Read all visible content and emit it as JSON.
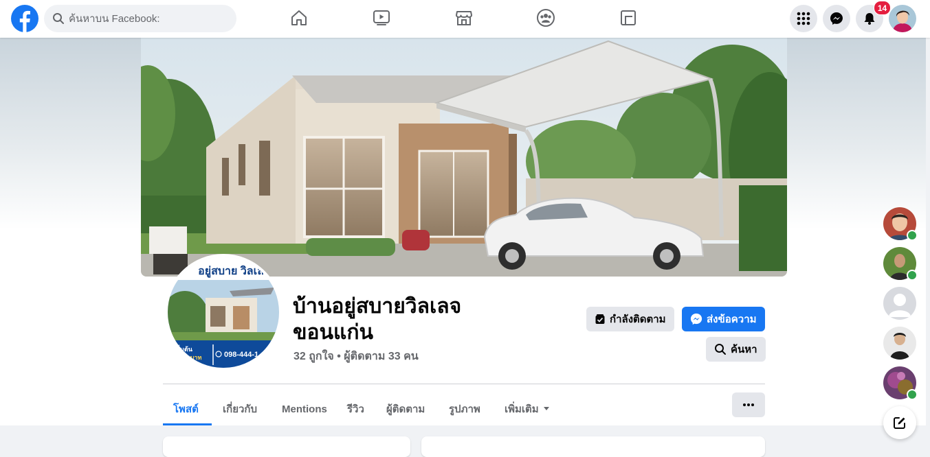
{
  "search": {
    "placeholder": "ค้นหาบน Facebook:"
  },
  "header": {
    "notification_count": "14",
    "colors": {
      "brand": "#1877f2",
      "badge": "#e41e3f",
      "online": "#31a24c"
    },
    "nav_icons": [
      "home-icon",
      "watch-icon",
      "marketplace-icon",
      "groups-icon",
      "gaming-icon"
    ],
    "action_icons": [
      "menu-grid-icon",
      "messenger-icon",
      "bell-icon"
    ]
  },
  "profile": {
    "name_line1": "บ้านอยู่สบายวิลเลจ",
    "name_line2": "ขอนแก่น",
    "stats": "32 ถูกใจ • ผู้ติดตาม 33 คน",
    "pic_banner": "อยู่สบาย วิลเล",
    "pic_price_prefix": "เริ่มต้น",
    "pic_price_unit": "ล้านบาท",
    "pic_phone": "098-444-1"
  },
  "actions": {
    "following_label": "กำลังติดตาม",
    "message_label": "ส่งข้อความ",
    "search_label": "ค้นหา"
  },
  "tabs": [
    {
      "label": "โพสต์",
      "active": true
    },
    {
      "label": "เกี่ยวกับ"
    },
    {
      "label": "Mentions"
    },
    {
      "label": "รีวิว"
    },
    {
      "label": "ผู้ติดตาม"
    },
    {
      "label": "รูปภาพ"
    },
    {
      "label": "เพิ่มเติม"
    }
  ],
  "contacts": [
    {
      "online": true
    },
    {
      "online": true
    },
    {
      "online": false
    },
    {
      "online": false
    },
    {
      "online": true
    }
  ]
}
